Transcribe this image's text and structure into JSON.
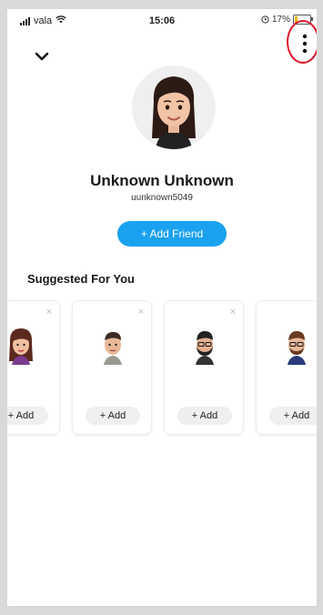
{
  "status_bar": {
    "carrier": "vala",
    "time": "15:06",
    "battery_percent": "17%",
    "battery_level": 0.17
  },
  "header": {
    "back_icon": "chevron-down-icon",
    "menu_icon": "more-vertical-icon"
  },
  "profile": {
    "display_name": "Unknown Unknown",
    "username": "uunknown5049",
    "add_friend_label": "+ Add Friend"
  },
  "suggested": {
    "title": "Suggested For You",
    "dismiss_glyph": "×",
    "cards": [
      {
        "add_label": "+ Add",
        "avatar": "woman-bitmoji"
      },
      {
        "add_label": "+ Add",
        "avatar": "man-bitmoji"
      },
      {
        "add_label": "+ Add",
        "avatar": "bearded-man-bitmoji"
      },
      {
        "add_label": "+ Add",
        "avatar": "glasses-man-bitmoji"
      }
    ]
  },
  "colors": {
    "accent": "#1aa1f0",
    "annotation": "#e0182c"
  }
}
